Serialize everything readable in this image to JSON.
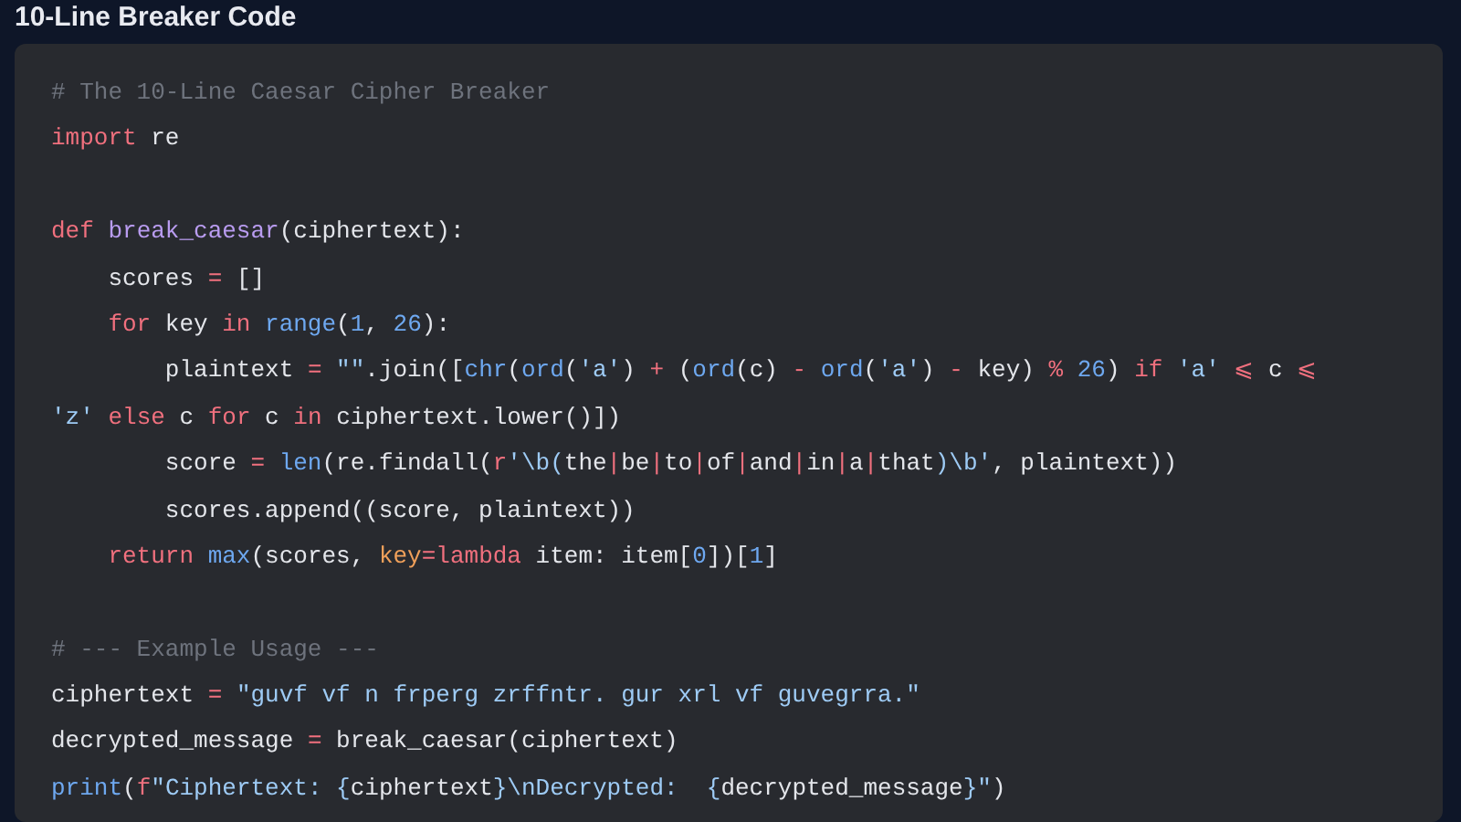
{
  "heading": "10-Line Breaker Code",
  "code_lines": [
    {
      "kind": "code",
      "tokens": [
        {
          "kind": "comment",
          "text": "# The 10-Line Caesar Cipher Breaker"
        }
      ]
    },
    {
      "kind": "code",
      "tokens": [
        {
          "kind": "keyword",
          "text": "import"
        },
        {
          "kind": "plain",
          "text": " re"
        }
      ]
    },
    {
      "kind": "blank"
    },
    {
      "kind": "code",
      "tokens": [
        {
          "kind": "keyword",
          "text": "def "
        },
        {
          "kind": "function",
          "text": "break_caesar"
        },
        {
          "kind": "plain",
          "text": "(ciphertext):"
        }
      ]
    },
    {
      "kind": "code",
      "tokens": [
        {
          "kind": "plain",
          "text": "    scores "
        },
        {
          "kind": "operator",
          "text": "="
        },
        {
          "kind": "plain",
          "text": " []"
        }
      ]
    },
    {
      "kind": "code",
      "tokens": [
        {
          "kind": "keyword",
          "text": "    for"
        },
        {
          "kind": "plain",
          "text": " key "
        },
        {
          "kind": "keyword",
          "text": "in "
        },
        {
          "kind": "builtin",
          "text": "range"
        },
        {
          "kind": "plain",
          "text": "("
        },
        {
          "kind": "number",
          "text": "1"
        },
        {
          "kind": "plain",
          "text": ", "
        },
        {
          "kind": "number",
          "text": "26"
        },
        {
          "kind": "plain",
          "text": "):"
        }
      ]
    },
    {
      "kind": "code",
      "tokens": [
        {
          "kind": "plain",
          "text": "        plaintext "
        },
        {
          "kind": "operator",
          "text": "= "
        },
        {
          "kind": "string",
          "text": "\"\""
        },
        {
          "kind": "plain",
          "text": ".join(["
        },
        {
          "kind": "builtin",
          "text": "chr"
        },
        {
          "kind": "plain",
          "text": "("
        },
        {
          "kind": "builtin",
          "text": "ord"
        },
        {
          "kind": "plain",
          "text": "("
        },
        {
          "kind": "string",
          "text": "'a'"
        },
        {
          "kind": "plain",
          "text": ") "
        },
        {
          "kind": "operator",
          "text": "+"
        },
        {
          "kind": "plain",
          "text": " ("
        },
        {
          "kind": "builtin",
          "text": "ord"
        },
        {
          "kind": "plain",
          "text": "(c) "
        },
        {
          "kind": "operator",
          "text": "- "
        },
        {
          "kind": "builtin",
          "text": "ord"
        },
        {
          "kind": "plain",
          "text": "("
        },
        {
          "kind": "string",
          "text": "'a'"
        },
        {
          "kind": "plain",
          "text": ") "
        },
        {
          "kind": "operator",
          "text": "-"
        },
        {
          "kind": "plain",
          "text": " key) "
        },
        {
          "kind": "operator",
          "text": "% "
        },
        {
          "kind": "number",
          "text": "26"
        },
        {
          "kind": "plain",
          "text": ") "
        },
        {
          "kind": "keyword",
          "text": "if "
        },
        {
          "kind": "string",
          "text": "'a' "
        },
        {
          "kind": "operator",
          "text": "⩽"
        },
        {
          "kind": "plain",
          "text": " c "
        },
        {
          "kind": "operator",
          "text": "⩽"
        }
      ]
    },
    {
      "kind": "code",
      "tokens": [
        {
          "kind": "string",
          "text": "'z' "
        },
        {
          "kind": "keyword",
          "text": "else"
        },
        {
          "kind": "plain",
          "text": " c "
        },
        {
          "kind": "keyword",
          "text": "for"
        },
        {
          "kind": "plain",
          "text": " c "
        },
        {
          "kind": "keyword",
          "text": "in"
        },
        {
          "kind": "plain",
          "text": " ciphertext.lower()])"
        }
      ]
    },
    {
      "kind": "code",
      "tokens": [
        {
          "kind": "plain",
          "text": "        score "
        },
        {
          "kind": "operator",
          "text": "= "
        },
        {
          "kind": "builtin",
          "text": "len"
        },
        {
          "kind": "plain",
          "text": "(re.findall("
        },
        {
          "kind": "keyword",
          "text": "r"
        },
        {
          "kind": "string",
          "text": "'\\b("
        },
        {
          "kind": "plain",
          "text": "the"
        },
        {
          "kind": "operator",
          "text": "|"
        },
        {
          "kind": "plain",
          "text": "be"
        },
        {
          "kind": "operator",
          "text": "|"
        },
        {
          "kind": "plain",
          "text": "to"
        },
        {
          "kind": "operator",
          "text": "|"
        },
        {
          "kind": "plain",
          "text": "of"
        },
        {
          "kind": "operator",
          "text": "|"
        },
        {
          "kind": "plain",
          "text": "and"
        },
        {
          "kind": "operator",
          "text": "|"
        },
        {
          "kind": "plain",
          "text": "in"
        },
        {
          "kind": "operator",
          "text": "|"
        },
        {
          "kind": "plain",
          "text": "a"
        },
        {
          "kind": "operator",
          "text": "|"
        },
        {
          "kind": "plain",
          "text": "that"
        },
        {
          "kind": "string",
          "text": ")\\b'"
        },
        {
          "kind": "plain",
          "text": ", plaintext))"
        }
      ]
    },
    {
      "kind": "code",
      "tokens": [
        {
          "kind": "plain",
          "text": "        scores.append((score, plaintext))"
        }
      ]
    },
    {
      "kind": "code",
      "tokens": [
        {
          "kind": "keyword",
          "text": "    return "
        },
        {
          "kind": "builtin",
          "text": "max"
        },
        {
          "kind": "plain",
          "text": "(scores, "
        },
        {
          "kind": "param",
          "text": "key"
        },
        {
          "kind": "operator",
          "text": "="
        },
        {
          "kind": "keyword",
          "text": "lambda"
        },
        {
          "kind": "plain",
          "text": " item: item["
        },
        {
          "kind": "number",
          "text": "0"
        },
        {
          "kind": "plain",
          "text": "])["
        },
        {
          "kind": "number",
          "text": "1"
        },
        {
          "kind": "plain",
          "text": "]"
        }
      ]
    },
    {
      "kind": "blank"
    },
    {
      "kind": "code",
      "tokens": [
        {
          "kind": "comment",
          "text": "# --- Example Usage ---"
        }
      ]
    },
    {
      "kind": "code",
      "tokens": [
        {
          "kind": "plain",
          "text": "ciphertext "
        },
        {
          "kind": "operator",
          "text": "= "
        },
        {
          "kind": "string",
          "text": "\"guvf vf n frperg zrffntr. gur xrl vf guvegrra.\""
        }
      ]
    },
    {
      "kind": "code",
      "tokens": [
        {
          "kind": "plain",
          "text": "decrypted_message "
        },
        {
          "kind": "operator",
          "text": "="
        },
        {
          "kind": "plain",
          "text": " break_caesar(ciphertext)"
        }
      ]
    },
    {
      "kind": "code",
      "tokens": [
        {
          "kind": "builtin",
          "text": "print"
        },
        {
          "kind": "plain",
          "text": "("
        },
        {
          "kind": "keyword",
          "text": "f"
        },
        {
          "kind": "string",
          "text": "\"Ciphertext: {"
        },
        {
          "kind": "plain",
          "text": "ciphertext"
        },
        {
          "kind": "string",
          "text": "}\\nDecrypted:  {"
        },
        {
          "kind": "plain",
          "text": "decrypted_message"
        },
        {
          "kind": "string",
          "text": "}\""
        },
        {
          "kind": "plain",
          "text": ")"
        }
      ]
    }
  ]
}
